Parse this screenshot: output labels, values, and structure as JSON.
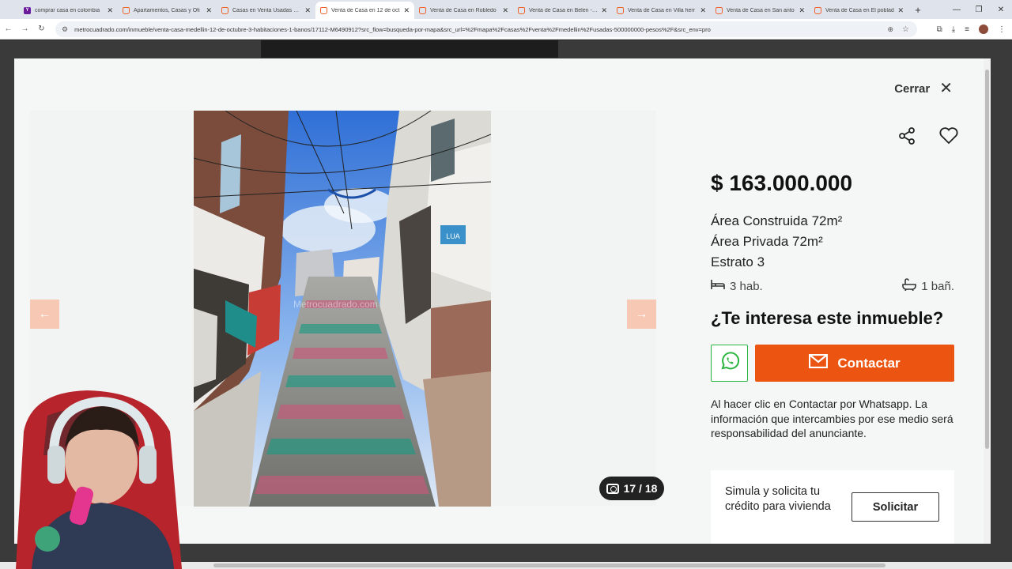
{
  "browser": {
    "tabs": [
      {
        "label": "comprar casa en colombia",
        "favicon": "yahoo",
        "active": false
      },
      {
        "label": "Apartamentos, Casas y Ofi",
        "favicon": "metrocuadrado",
        "active": false
      },
      {
        "label": "Casas en Venta Usadas 500",
        "favicon": "metrocuadrado",
        "active": false
      },
      {
        "label": "Venta de Casa en 12 de oct",
        "favicon": "metrocuadrado",
        "active": true
      },
      {
        "label": "Venta de Casa en Robledo",
        "favicon": "metrocuadrado",
        "active": false
      },
      {
        "label": "Venta de Casa en Belen - M",
        "favicon": "metrocuadrado",
        "active": false
      },
      {
        "label": "Venta de Casa en Villa herr",
        "favicon": "metrocuadrado",
        "active": false
      },
      {
        "label": "Venta de Casa en San anto",
        "favicon": "metrocuadrado",
        "active": false
      },
      {
        "label": "Venta de Casa en El poblad",
        "favicon": "metrocuadrado",
        "active": false
      }
    ],
    "url": "metrocuadrado.com/inmueble/venta-casa-medellin-12-de-octubre-3-habitaciones-1-banos/17112-M6490912?src_flow=busqueda-por-mapa&src_url=%2Fmapa%2Fcasas%2Fventa%2Fmedellin%2Fusadas-500000000-pesos%2F&src_env=pro"
  },
  "modal": {
    "close_label": "Cerrar",
    "watermark": "Metrocuadrado.com",
    "photo_counter": "17 / 18"
  },
  "listing": {
    "price": "$ 163.000.000",
    "area_built": "Área Construida 72m²",
    "area_private": "Área Privada 72m²",
    "estrato": "Estrato 3",
    "rooms": "3 hab.",
    "baths": "1 bañ.",
    "interest_heading": "¿Te interesa este inmueble?",
    "contact_label": "Contactar",
    "disclaimer": "Al hacer clic en Contactar por Whatsapp. La información que intercambies por ese medio será responsabilidad del anunciante.",
    "credit_text": "Simula y solicita tu crédito para vivienda",
    "credit_button": "Solicitar"
  },
  "colors": {
    "accent": "#ec5511",
    "whatsapp": "#2ab540",
    "arrow_bg": "#f7c9b4"
  }
}
